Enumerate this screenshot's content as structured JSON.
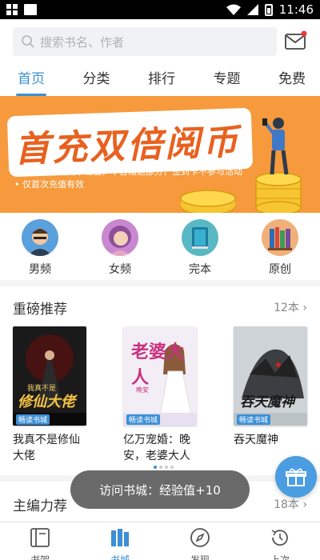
{
  "status_bar": {
    "time": "11:46"
  },
  "search": {
    "placeholder": "搜索书名、作者"
  },
  "tabs": [
    {
      "label": "首页",
      "active": true
    },
    {
      "label": "分类"
    },
    {
      "label": "排行"
    },
    {
      "label": "专题"
    },
    {
      "label": "免费"
    }
  ],
  "banner": {
    "title": "首充双倍阅币",
    "lines": [
      "适用于所有阅币档位，不含赠送部分，签到卡不参与活动",
      "仅首次充值有效"
    ]
  },
  "categories": [
    {
      "label": "男频",
      "icon": "male-avatar-icon"
    },
    {
      "label": "女频",
      "icon": "female-avatar-icon"
    },
    {
      "label": "完本",
      "icon": "book-icon"
    },
    {
      "label": "原创",
      "icon": "bookshelf-icon"
    }
  ],
  "section1": {
    "title": "重磅推荐",
    "count": "12本",
    "books": [
      {
        "title": "我真不是修仙大佬",
        "cover_text": "修仙大佬",
        "cover_sub": "我真不是",
        "badge": "畅读书城"
      },
      {
        "title": "亿万宠婚：晚安，老婆大人",
        "cover_text": "老婆大人",
        "cover_sub": "晚安",
        "badge": "畅读书城"
      },
      {
        "title": "吞天魔神",
        "cover_text": "吞天魔神",
        "cover_sub": "",
        "badge": "畅读书城"
      }
    ]
  },
  "section2": {
    "title": "主编力荐",
    "count": "18本"
  },
  "toast": "访问书城：经验值+10",
  "bottom_nav": [
    {
      "label": "书架",
      "icon": "bookshelf-nav-icon"
    },
    {
      "label": "书城",
      "icon": "bookstore-nav-icon",
      "active": true
    },
    {
      "label": "发现",
      "icon": "compass-icon"
    },
    {
      "label": "上次",
      "icon": "history-icon"
    }
  ],
  "colors": {
    "accent": "#3b8fd6",
    "banner": "#f69a3d"
  }
}
